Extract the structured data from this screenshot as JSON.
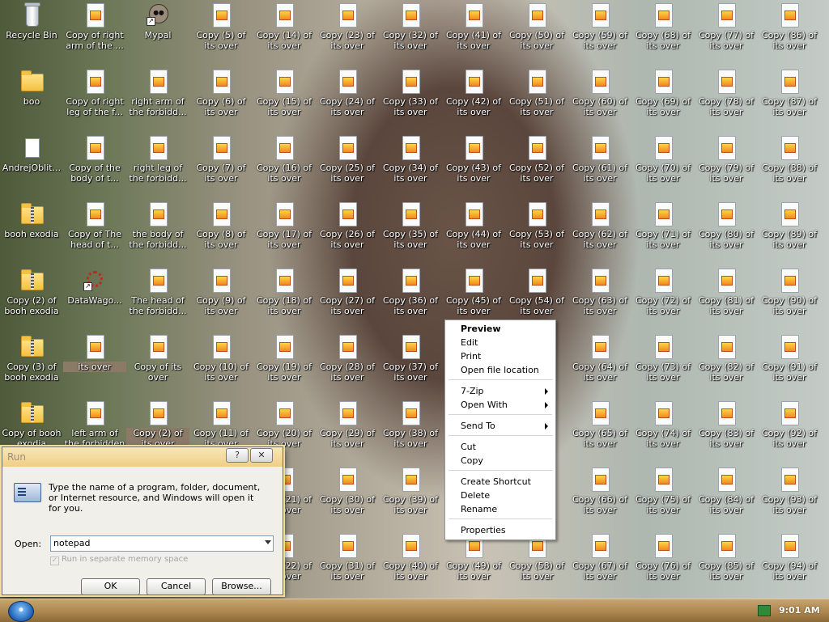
{
  "desktop": {
    "special_icons": [
      {
        "label": "Recycle Bin",
        "icon": "recycle-bin-icon"
      },
      {
        "label": "boo",
        "icon": "folder-icon"
      },
      {
        "label": "AndrejOblit...",
        "icon": "file-icon"
      },
      {
        "label": "booh exodia",
        "icon": "zip-folder-icon"
      },
      {
        "label": "Copy (2) of booh exodia",
        "icon": "zip-folder-icon"
      },
      {
        "label": "Copy (3) of booh exodia",
        "icon": "zip-folder-icon"
      },
      {
        "label": "Copy of booh exodia",
        "icon": "zip-folder-icon"
      },
      {
        "label": "Copy of right arm of the ...",
        "icon": "document-icon"
      },
      {
        "label": "Copy of right leg of the f...",
        "icon": "document-icon"
      },
      {
        "label": "Copy of the body of t...",
        "icon": "document-icon"
      },
      {
        "label": "Copy of The head of t...",
        "icon": "document-icon"
      },
      {
        "label": "DataWago...",
        "icon": "gear-shortcut-icon"
      },
      {
        "label": "its over",
        "icon": "document-icon"
      },
      {
        "label": "left arm of the forbidden o...",
        "icon": "document-icon"
      },
      {
        "label": "Mypal",
        "icon": "raccoon-shortcut-icon"
      },
      {
        "label": "right arm of the forbidd...",
        "icon": "document-icon"
      },
      {
        "label": "right leg of the forbidd...",
        "icon": "document-icon"
      },
      {
        "label": "the body of the forbidd...",
        "icon": "document-icon"
      },
      {
        "label": "The head of the forbidd...",
        "icon": "document-icon"
      },
      {
        "label": "Copy of its over",
        "icon": "document-icon"
      },
      {
        "label": "Copy (2) of its over",
        "icon": "document-icon"
      }
    ],
    "copy_labels": [
      "Copy (5) of its over",
      "Copy (6) of its over",
      "Copy (7) of its over",
      "Copy (8) of its over",
      "Copy (9) of its over",
      "Copy (10) of its over",
      "Copy (11) of its over",
      "Copy (14) of its over",
      "Copy (15) of its over",
      "Copy (16) of its over",
      "Copy (17) of its over",
      "Copy (18) of its over",
      "Copy (19) of its over",
      "Copy (20) of its over",
      "Copy (21) of its over",
      "Copy (22) of its over",
      "Copy (23) of its over",
      "Copy (24) of its over",
      "Copy (25) of its over",
      "Copy (26) of its over",
      "Copy (27) of its over",
      "Copy (28) of its over",
      "Copy (29) of its over",
      "Copy (30) of its over",
      "Copy (31) of its over",
      "Copy (32) of its over",
      "Copy (33) of its over",
      "Copy (34) of its over",
      "Copy (35) of its over",
      "Copy (36) of its over",
      "Copy (37) of its over",
      "Copy (38) of its over",
      "Copy (39) of its over",
      "Copy (40) of its over",
      "Copy (41) of its over",
      "Copy (42) of its over",
      "Copy (43) of its over",
      "Copy (44) of its over",
      "Copy (45) of its over",
      "Copy (49) of its over",
      "Copy (50) of its over",
      "Copy (51) of its over",
      "Copy (52) of its over",
      "Copy (53) of its over",
      "Copy (54) of its over",
      "Copy (58) of its over",
      "Copy (59) of its over",
      "Copy (60) of its over",
      "Copy (61) of its over",
      "Copy (62) of its over",
      "Copy (63) of its over",
      "Copy (64) of its over",
      "Copy (65) of its over",
      "Copy (66) of its over",
      "Copy (67) of its over",
      "Copy (68) of its over",
      "Copy (69) of its over",
      "Copy (70) of its over",
      "Copy (71) of its over",
      "Copy (72) of its over",
      "Copy (73) of its over",
      "Copy (74) of its over",
      "Copy (75) of its over",
      "Copy (76) of its over",
      "Copy (77) of its over",
      "Copy (78) of its over",
      "Copy (79) of its over",
      "Copy (80) of its over",
      "Copy (81) of its over",
      "Copy (82) of its over",
      "Copy (83) of its over",
      "Copy (84) of its over",
      "Copy (85) of its over",
      "Copy (86) of its over",
      "Copy (87) of its over",
      "Copy (88) of its over",
      "Copy (89) of its over",
      "Copy (90) of its over",
      "Copy (91) of its over",
      "Copy (92) of its over",
      "Copy (93) of its over",
      "Copy (94) of its over"
    ]
  },
  "run_dialog": {
    "title": "Run",
    "help_btn": "?",
    "close_btn": "✕",
    "description": "Type the name of a program, folder, document, or Internet resource, and Windows will open it for you.",
    "open_label": "Open:",
    "open_value": "notepad",
    "separate_memory": "Run in separate memory space",
    "ok": "OK",
    "cancel": "Cancel",
    "browse": "Browse..."
  },
  "context_menu": {
    "preview": "Preview",
    "edit": "Edit",
    "print": "Print",
    "open_file_location": "Open file location",
    "seven_zip": "7-Zip",
    "open_with": "Open With",
    "send_to": "Send To",
    "cut": "Cut",
    "copy": "Copy",
    "create_shortcut": "Create Shortcut",
    "delete": "Delete",
    "rename": "Rename",
    "properties": "Properties"
  },
  "taskbar": {
    "clock": "9:01 AM"
  },
  "colors": {
    "taskbar": "#a9844c",
    "selection": "#8a7a66"
  }
}
